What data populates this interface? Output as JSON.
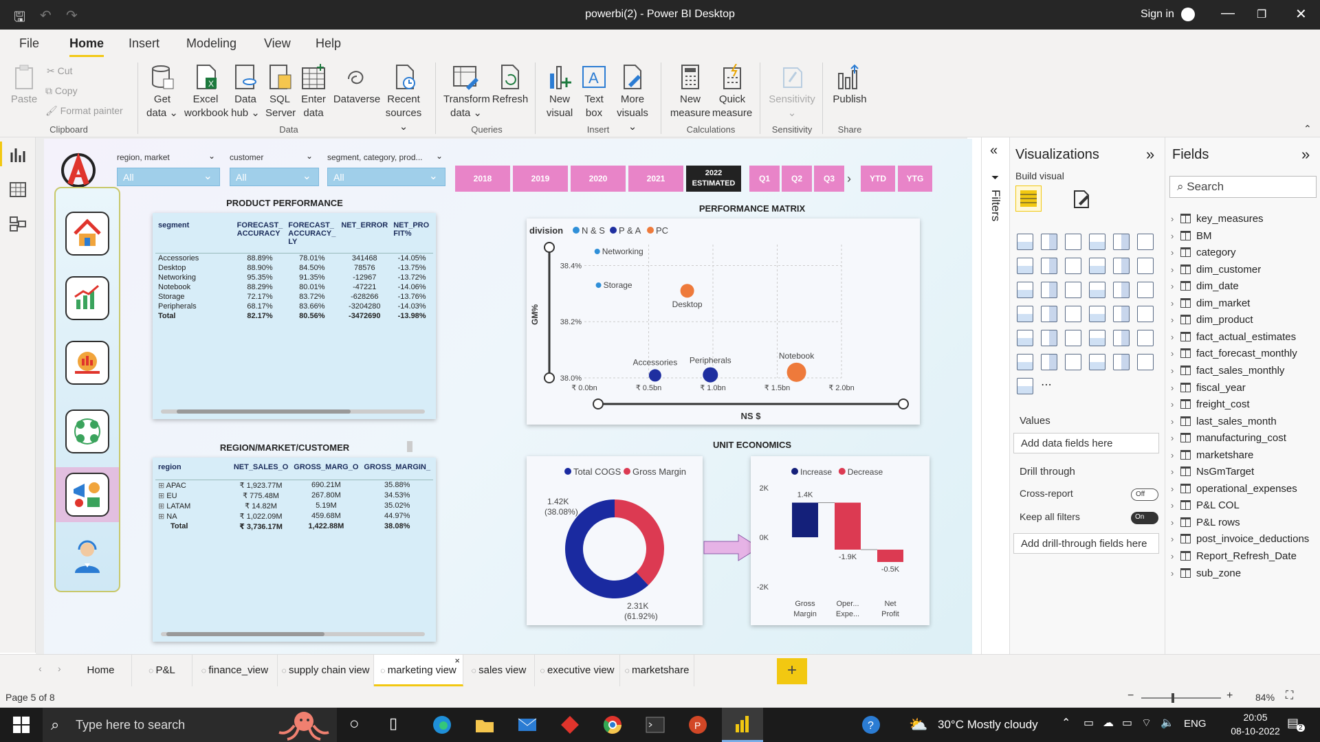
{
  "app": {
    "title": "powerbi(2) - Power BI Desktop",
    "sign_in": "Sign in"
  },
  "menu": [
    "File",
    "Home",
    "Insert",
    "Modeling",
    "View",
    "Help"
  ],
  "ribbon": {
    "clipboard": {
      "paste": "Paste",
      "cut": "Cut",
      "copy": "Copy",
      "format_painter": "Format painter",
      "group": "Clipboard"
    },
    "data": {
      "get_data": "Get data",
      "excel": "Excel workbook",
      "data_hub": "Data hub",
      "sql": "SQL Server",
      "enter_data": "Enter data",
      "dataverse": "Dataverse",
      "recent": "Recent sources",
      "group": "Data"
    },
    "queries": {
      "transform": "Transform data",
      "refresh": "Refresh",
      "group": "Queries"
    },
    "insert": {
      "new_visual": "New visual",
      "text_box": "Text box",
      "more_visuals": "More visuals",
      "group": "Insert"
    },
    "calculations": {
      "new_measure": "New measure",
      "quick_measure": "Quick measure",
      "group": "Calculations"
    },
    "sensitivity": {
      "label": "Sensitivity",
      "group": "Sensitivity"
    },
    "share": {
      "publish": "Publish",
      "group": "Share"
    }
  },
  "slicers": [
    {
      "label": "region, market",
      "value": "All"
    },
    {
      "label": "customer",
      "value": "All"
    },
    {
      "label": "segment, category, prod...",
      "value": "All"
    }
  ],
  "year_buttons": [
    "2018",
    "2019",
    "2020",
    "2021"
  ],
  "year_estimated": [
    "2022",
    "ESTIMATED"
  ],
  "quarter_buttons": [
    "Q1",
    "Q2",
    "Q3"
  ],
  "ytd_buttons": [
    "YTD",
    "YTG"
  ],
  "product_performance": {
    "title": "PRODUCT PERFORMANCE",
    "headers": [
      "segment",
      "FORECAST_ ACCURACY",
      "FORECAST_ ACCURACY_ LY",
      "NET_ERROR",
      "NET_PRO FIT%"
    ],
    "rows": [
      [
        "Accessories",
        "88.89%",
        "78.01%",
        "341468",
        "-14.05%"
      ],
      [
        "Desktop",
        "88.90%",
        "84.50%",
        "78576",
        "-13.75%"
      ],
      [
        "Networking",
        "95.35%",
        "91.35%",
        "-12967",
        "-13.72%"
      ],
      [
        "Notebook",
        "88.29%",
        "80.01%",
        "-47221",
        "-14.06%"
      ],
      [
        "Storage",
        "72.17%",
        "83.72%",
        "-628266",
        "-13.76%"
      ],
      [
        "Peripherals",
        "68.17%",
        "83.66%",
        "-3204280",
        "-14.03%"
      ]
    ],
    "total": [
      "Total",
      "82.17%",
      "80.56%",
      "-3472690",
      "-13.98%"
    ]
  },
  "region_table": {
    "title": "REGION/MARKET/CUSTOMER",
    "headers": [
      "region",
      "NET_SALES_O",
      "GROSS_MARG_O",
      "GROSS_MARGIN_"
    ],
    "rows": [
      [
        "APAC",
        "₹ 1,923.77M",
        "690.21M",
        "35.88%"
      ],
      [
        "EU",
        "₹ 775.48M",
        "267.80M",
        "34.53%"
      ],
      [
        "LATAM",
        "₹ 14.82M",
        "5.19M",
        "35.02%"
      ],
      [
        "NA",
        "₹ 1,022.09M",
        "459.68M",
        "44.97%"
      ]
    ],
    "total": [
      "Total",
      "₹ 3,736.17M",
      "1,422.88M",
      "38.08%"
    ]
  },
  "chart_data": [
    {
      "type": "scatter",
      "title": "PERFORMANCE MATRIX",
      "xlabel": "NS $",
      "ylabel": "GM%",
      "legend_title": "division",
      "legend": [
        {
          "name": "N & S",
          "color": "#2f8fd8"
        },
        {
          "name": "P & A",
          "color": "#1f2fa0"
        },
        {
          "name": "PC",
          "color": "#ee7a3b"
        }
      ],
      "xlim": [
        0,
        2.0
      ],
      "ylim": [
        38.0,
        38.45
      ],
      "x_ticks": [
        "₹ 0.0bn",
        "₹ 0.5bn",
        "₹ 1.0bn",
        "₹ 1.5bn",
        "₹ 2.0bn"
      ],
      "y_ticks": [
        "38.4%",
        "38.2%",
        "38.0%"
      ],
      "points": [
        {
          "label": "Networking",
          "division": "N & S",
          "x": 0.1,
          "y": 38.45,
          "size": 4
        },
        {
          "label": "Storage",
          "division": "N & S",
          "x": 0.11,
          "y": 38.33,
          "size": 4
        },
        {
          "label": "Desktop",
          "division": "PC",
          "x": 0.8,
          "y": 38.31,
          "size": 10
        },
        {
          "label": "Accessories",
          "division": "P & A",
          "x": 0.55,
          "y": 38.0,
          "size": 9
        },
        {
          "label": "Peripherals",
          "division": "P & A",
          "x": 0.98,
          "y": 38.01,
          "size": 11
        },
        {
          "label": "Notebook",
          "division": "PC",
          "x": 1.65,
          "y": 38.02,
          "size": 14
        }
      ]
    },
    {
      "type": "pie",
      "title": "UNIT ECONOMICS",
      "legend": [
        {
          "name": "Total COGS",
          "color": "#1a2aa0"
        },
        {
          "name": "Gross Margin",
          "color": "#dc3a52"
        }
      ],
      "slices": [
        {
          "name": "Total COGS",
          "value": 2.31,
          "label": "2.31K",
          "pct": "(61.92%)"
        },
        {
          "name": "Gross Margin",
          "value": 1.42,
          "label": "1.42K",
          "pct": "(38.08%)"
        }
      ]
    },
    {
      "type": "bar",
      "subtype": "waterfall",
      "legend": [
        {
          "name": "Increase",
          "color": "#14207a"
        },
        {
          "name": "Decrease",
          "color": "#dc3a52"
        }
      ],
      "categories": [
        "Gross Margin",
        "Oper... Expe...",
        "Net Profit"
      ],
      "values": [
        1.4,
        -1.9,
        -0.5
      ],
      "labels": [
        "1.4K",
        "-1.9K",
        "-0.5K"
      ],
      "y_ticks": [
        "2K",
        "0K",
        "-2K"
      ],
      "ylim": [
        -2,
        2
      ]
    }
  ],
  "panes": {
    "filters": "Filters",
    "visualizations": "Visualizations",
    "build_visual": "Build visual",
    "values": "Values",
    "add_data": "Add data fields here",
    "drill_through": "Drill through",
    "cross_report": "Cross-report",
    "cross_report_state": "Off",
    "keep_filters": "Keep all filters",
    "keep_filters_state": "On",
    "add_drill": "Add drill-through fields here",
    "fields": "Fields",
    "search": "Search"
  },
  "fields": [
    "key_measures",
    "BM",
    "category",
    "dim_customer",
    "dim_date",
    "dim_market",
    "dim_product",
    "fact_actual_estimates",
    "fact_forecast_monthly",
    "fact_sales_monthly",
    "fiscal_year",
    "freight_cost",
    "last_sales_month",
    "manufacturing_cost",
    "marketshare",
    "NsGmTarget",
    "operational_expenses",
    "P&L COL",
    "P&L rows",
    "post_invoice_deductions",
    "Report_Refresh_Date",
    "sub_zone"
  ],
  "tabs": [
    "Home",
    "P&L",
    "finance_view",
    "supply chain view",
    "marketing view",
    "sales view",
    "executive view",
    "marketshare"
  ],
  "active_tab": "marketing view",
  "status": {
    "page": "Page 5 of 8",
    "zoom": "84%"
  },
  "taskbar": {
    "search": "Type here to search",
    "weather": "30°C  Mostly cloudy",
    "lang": "ENG",
    "time": "20:05",
    "date": "08-10-2022",
    "notif": "2"
  },
  "colors": {
    "accent": "#f2c811",
    "slicer": "#a0cfea",
    "year_btn": "#e884c8"
  }
}
